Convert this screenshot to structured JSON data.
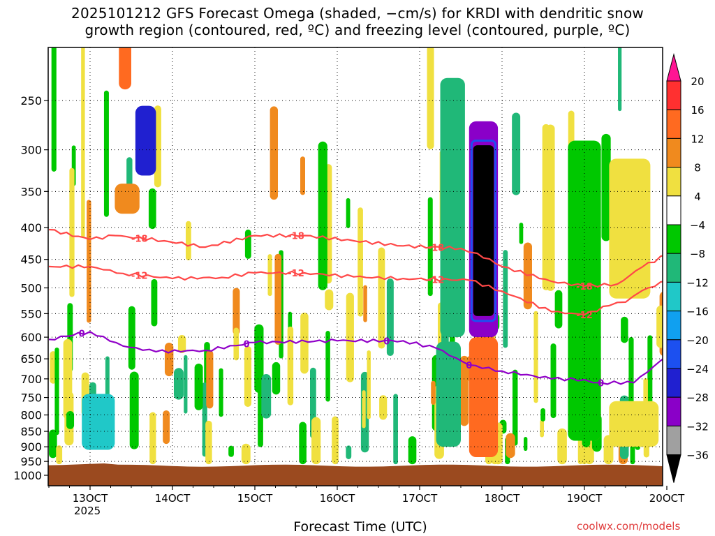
{
  "title": {
    "line1": "2025101212 GFS Forecast Omega (shaded, −cm/s) for KRDI with dendritic snow",
    "line2": "growth region (contoured, red, ºC) and freezing level (contoured, purple, ºC)"
  },
  "credit": "coolwx.com/models",
  "chart_data": {
    "type": "heatmap",
    "title": "2025101212 GFS Forecast Omega (shaded, −cm/s) for KRDI with dendritic snow growth region (contoured, red, ºC) and freezing level (contoured, purple, ºC)",
    "xlabel": "Forecast Time (UTC)",
    "ylabel": "",
    "x_axis": {
      "ticks": [
        "13OCT",
        "14OCT",
        "15OCT",
        "16OCT",
        "17OCT",
        "18OCT",
        "19OCT",
        "20OCT"
      ],
      "year_label": "2025",
      "range": [
        "2025-10-12 12Z",
        "2025-10-20 00Z"
      ]
    },
    "y_axis": {
      "ticks": [
        250,
        300,
        350,
        400,
        450,
        500,
        550,
        600,
        650,
        700,
        750,
        800,
        850,
        900,
        950,
        1000
      ],
      "range_hPa": [
        200,
        1020
      ],
      "scale": "log-pressure, inverted"
    },
    "grid": "dotted",
    "colorbar": {
      "labels": [
        20,
        16,
        12,
        8,
        4,
        -4,
        -8,
        -12,
        -16,
        -20,
        -24,
        -28,
        -32,
        -36
      ],
      "colors": [
        "#ff1493",
        "#ff3030",
        "#ff6a20",
        "#f08a1e",
        "#e8b830",
        "#f0e040",
        "#ffffff",
        "#00c800",
        "#20b878",
        "#20c8c8",
        "#10a0f0",
        "#1c50f0",
        "#2020d0",
        "#8a00c8",
        "#a0a0a0",
        "#000000"
      ]
    },
    "contours": [
      {
        "label": "-18",
        "color": "#ff4848",
        "level_hPa": [
          [
            12.5,
            403
          ],
          [
            13.0,
            418
          ],
          [
            13.3,
            412
          ],
          [
            13.9,
            420
          ],
          [
            14.4,
            430
          ],
          [
            15.0,
            412
          ],
          [
            15.6,
            412
          ],
          [
            16.2,
            420
          ],
          [
            16.8,
            428
          ],
          [
            17.5,
            432
          ],
          [
            17.7,
            440
          ],
          [
            18.0,
            462
          ],
          [
            18.6,
            488
          ],
          [
            19.0,
            497
          ],
          [
            19.4,
            493
          ],
          [
            19.7,
            463
          ],
          [
            20.0,
            442
          ]
        ]
      },
      {
        "label": "-12",
        "color": "#ff4848",
        "level_hPa": [
          [
            12.5,
            462
          ],
          [
            13.0,
            462
          ],
          [
            13.4,
            474
          ],
          [
            14.0,
            483
          ],
          [
            14.6,
            481
          ],
          [
            15.0,
            473
          ],
          [
            15.6,
            473
          ],
          [
            16.2,
            480
          ],
          [
            16.8,
            483
          ],
          [
            17.6,
            486
          ],
          [
            18.0,
            506
          ],
          [
            18.6,
            546
          ],
          [
            19.0,
            552
          ],
          [
            19.3,
            534
          ],
          [
            19.5,
            527
          ],
          [
            19.7,
            505
          ],
          [
            20.0,
            487
          ]
        ]
      },
      {
        "label": "0",
        "color": "#9000c8",
        "level_hPa": [
          [
            12.5,
            605
          ],
          [
            13.0,
            588
          ],
          [
            13.4,
            620
          ],
          [
            13.8,
            633
          ],
          [
            14.4,
            630
          ],
          [
            15.0,
            612
          ],
          [
            16.0,
            608
          ],
          [
            16.8,
            608
          ],
          [
            17.2,
            625
          ],
          [
            17.6,
            665
          ],
          [
            18.0,
            680
          ],
          [
            18.6,
            700
          ],
          [
            19.0,
            702
          ],
          [
            19.2,
            710
          ],
          [
            19.6,
            710
          ],
          [
            20.0,
            643
          ]
        ]
      }
    ],
    "omega_regions": [
      {
        "x": [
          17.65,
          17.9
        ],
        "p": [
          295,
          555
        ],
        "value": -40
      },
      {
        "x": [
          17.6,
          17.95
        ],
        "p": [
          270,
          600
        ],
        "value": -30
      },
      {
        "x": [
          17.65,
          17.9
        ],
        "p": [
          610,
          915
        ],
        "value": 20
      },
      {
        "x": [
          17.6,
          17.95
        ],
        "p": [
          600,
          935
        ],
        "value": 12
      },
      {
        "x": [
          13.55,
          13.8
        ],
        "p": [
          255,
          330
        ],
        "value": -24
      },
      {
        "x": [
          12.9,
          13.3
        ],
        "p": [
          740,
          910
        ],
        "value": -14
      },
      {
        "x": [
          13.35,
          13.5
        ],
        "p": [
          200,
          240
        ],
        "value": 14
      },
      {
        "x": [
          13.3,
          13.6
        ],
        "p": [
          340,
          380
        ],
        "value": 10
      },
      {
        "x": [
          19.0,
          19.2
        ],
        "p": [
          660,
          880
        ],
        "value": 10
      },
      {
        "x": [
          19.3,
          19.8
        ],
        "p": [
          310,
          520
        ],
        "value": 5
      },
      {
        "x": [
          19.3,
          19.9
        ],
        "p": [
          760,
          900
        ],
        "value": 5
      },
      {
        "x": [
          17.25,
          17.55
        ],
        "p": [
          230,
          600
        ],
        "value": -8
      },
      {
        "x": [
          17.2,
          17.5
        ],
        "p": [
          610,
          900
        ],
        "value": -8
      },
      {
        "x": [
          18.8,
          19.2
        ],
        "p": [
          290,
          880
        ],
        "value": -6
      }
    ],
    "terrain_hPa": 965
  }
}
